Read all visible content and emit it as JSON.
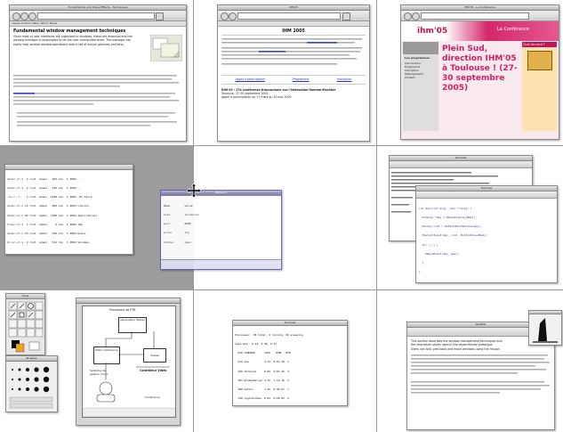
{
  "cells": {
    "c1": {
      "title": "Fundamental and Visual Effects - Techniques",
      "bookmarks": "Apple  Amazon  eBay  Yahoo!  News",
      "heading": "Fundamental window management techniques",
      "paragraphs": [
        "Since most of user interfaces are organized in windows, these are essential and the",
        "window manager is responsible to let the user manipulate them. The manager can",
        "easily map several window operations onto a set of mouse gestures and keys."
      ]
    },
    "c2": {
      "title": "IHM'05",
      "heading": "IHM 2005",
      "links": [
        "Appel à participation",
        "Programme",
        "Inscription"
      ],
      "list_items": [
        "IHM 05 : 17e conférence francophone sur l'Interaction Homme-Machine",
        "Toulouse, 27-30 septembre 2005",
        "Appel à participation du 17 mars au 15 mai 2005"
      ]
    },
    "c3": {
      "title": "IHM'05 - La Conférence",
      "brand": "ihm'05",
      "banner_title": "La Conférence",
      "big_text": "Plein Sud, direction IHM'05 à Toulouse ! (27-30 septembre 2005)",
      "right_heading": "Quoi de neuf ?",
      "left_heading": "Les programmes",
      "left_items": [
        "Introduction",
        "Programme",
        "Inscription",
        "Hébergement",
        "Contact"
      ]
    },
    "c4": {
      "terminal_lines": [
        "drwxr-xr-x  3 root  wheel   102 Jun  1 2004 .",
        "drwxr-xr-x  4 root  wheel   136 Jun  1 2004 ..",
        "-rw-r--r--  1 root  wheel  6148 Jun  1 2004 .DS_Store",
        "drwxr-xr-x 12 root  admin   408 Jun  1 2004 Library",
        "drwxr-xr-x 50 root  admin  1700 Jun  1 2004 Applications",
        "lrwxr-xr-x  1 root  admin     9 Jun  1 2004 tmp",
        "drwxr-xr-x 10 root  admin   340 Jun  1 2004 Users",
        "dr-xr-xr-x  2 root  wheel   512 Jun  1 2004 Volumes"
      ],
      "dialog_title": "Network",
      "dialog_lines": [
        "Name         Value",
        "host         localhost",
        "port         8080",
        "proto        tcp",
        "status       open"
      ]
    },
    "c5": {
      "top_title": "Terminal",
      "bottom_title": "Terminal",
      "code_lines": [
        "int main(int argc, char **argv) {",
        "  Display *dpy = XOpenDisplay(NULL);",
        "  Window root = DefaultRootWindow(dpy);",
        "  XSelectInput(dpy, root, ButtonPressMask);",
        "  for (;;) {",
        "    XNextEvent(dpy, &ev);",
        "  }",
        "}"
      ]
    },
    "c6": {
      "tool_title": "Tools",
      "brush_title": "Brushes",
      "diagram_labels": {
        "top": "Processeur de PTB",
        "external": "Générateur Stéréo",
        "left": "Piste Conférence",
        "right": "Invitée",
        "output": "Contrôleur Vidéo",
        "bottom_left": "Système de gestion micro",
        "bottom_right": "Conférence"
      }
    },
    "c8": {
      "title": "Terminal",
      "table_lines": [
        "Processes:  68 total, 2 running, 66 sleeping",
        "Load Avg:  0.42, 0.36, 0.31",
        "  PID COMMAND      %CPU   TIME   #TH",
        "  412 top          2.1%  0:01.20  1",
        "  398 Terminal     0.8%  0:03.45  4",
        "  301 WindowServer 4.3%  1:12.10  3",
        "  288 Safari       1.2%  0:45.67  7",
        "  120 loginwindow  0.0%  0:00.92  2"
      ]
    },
    "c9": {
      "title": "TextEdit",
      "paragraphs": [
        "This section describes the window management techniques and",
        "the interaction styles used in the experimental prototype.",
        "Users can fold, peel back and move windows using the mouse."
      ]
    }
  }
}
